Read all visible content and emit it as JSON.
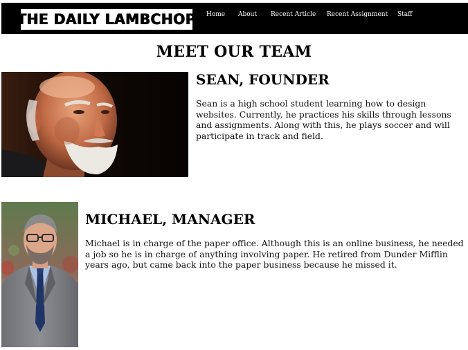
{
  "header": {
    "logo_text": "THE DAILY LAMBCHOP",
    "nav": {
      "home": "Home",
      "about": "About",
      "recent_article": "Recent Article",
      "recent_assignment": "Recent Assignment",
      "staff": "Staff"
    }
  },
  "main": {
    "title": "MEET OUR TEAM",
    "members": [
      {
        "heading": "SEAN, FOUNDER",
        "bio": "Sean is a high school student learning how to design websites. Currently, he practices his skills through lessons and assignments. Along with this, he plays soccer and will participate in track and field."
      },
      {
        "heading": "MICHAEL, MANAGER",
        "bio_lines": [
          "Michael is in charge of the paper office. Although this is an online business, he needed",
          "a job so he is in charge of anything involving paper. He retired from Dunder Mifflin",
          "years ago, but came back into the paper business because he missed it."
        ]
      }
    ]
  },
  "colors": {
    "header_bg": "#000000",
    "nav_text": "#ffffff",
    "page_bg": "#ffffff"
  }
}
